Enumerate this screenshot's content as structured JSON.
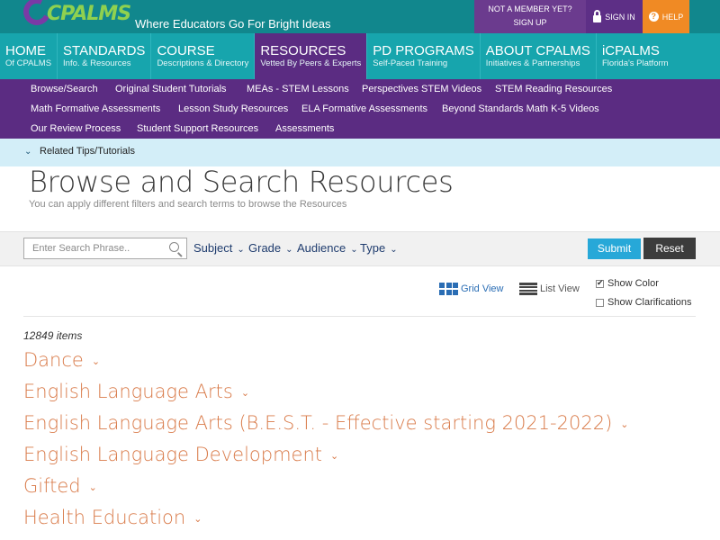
{
  "header": {
    "logo_text": "CPALMS",
    "tagline": "Where Educators Go For Bright Ideas",
    "member_line1": "NOT A MEMBER YET?",
    "member_line2": "SIGN UP",
    "sign_in": "SIGN IN",
    "help": "HELP",
    "icons": [
      "lock-icon",
      "question-icon"
    ],
    "colors": {
      "teal": "#11878d",
      "nav": "#17a5ad",
      "purple": "#5b2c82",
      "orange": "#f08a24"
    }
  },
  "nav": [
    {
      "title": "HOME",
      "sub": "Of CPALMS",
      "active": false
    },
    {
      "title": "STANDARDS",
      "sub": "Info. & Resources",
      "active": false
    },
    {
      "title": "COURSE",
      "sub": "Descriptions & Directory",
      "active": false
    },
    {
      "title": "RESOURCES",
      "sub": "Vetted By Peers & Experts",
      "active": true
    },
    {
      "title": "PD PROGRAMS",
      "sub": "Self-Paced Training",
      "active": false
    },
    {
      "title": "ABOUT CPALMS",
      "sub": "Initiatives & Partnerships",
      "active": false
    },
    {
      "title": "ICPALMS",
      "sub": "Florida's Platform",
      "active": false
    }
  ],
  "subnav": [
    [
      "Browse/Search",
      "Original Student Tutorials",
      "MEAs - STEM Lessons",
      "Perspectives STEM Videos",
      "STEM Reading Resources"
    ],
    [
      "Math Formative Assessments",
      "Lesson Study Resources",
      "ELA Formative Assessments",
      "Beyond Standards Math K-5 Videos"
    ],
    [
      "Our Review Process",
      "Student Support Resources",
      "Assessments"
    ]
  ],
  "tips": {
    "label": "Related Tips/Tutorials"
  },
  "page": {
    "title": "Browse and Search Resources",
    "subtitle": "You can apply different filters and search terms to browse the Resources"
  },
  "filters": {
    "search_placeholder": "Enter Search Phrase..",
    "search_value": "",
    "dropdowns": [
      "Subject",
      "Grade",
      "Audience",
      "Type"
    ],
    "submit": "Submit",
    "reset": "Reset"
  },
  "view": {
    "grid_label": "Grid View",
    "list_label": "List View",
    "show_color": "Show Color",
    "show_color_checked": true,
    "show_clarifications": "Show Clarifications",
    "show_clarifications_checked": false
  },
  "results": {
    "count": "12849 items",
    "subjects": [
      "Dance",
      "English Language Arts",
      "English Language Arts (B.E.S.T. - Effective starting 2021-2022)",
      "English Language Development",
      "Gifted",
      "Health Education"
    ]
  }
}
